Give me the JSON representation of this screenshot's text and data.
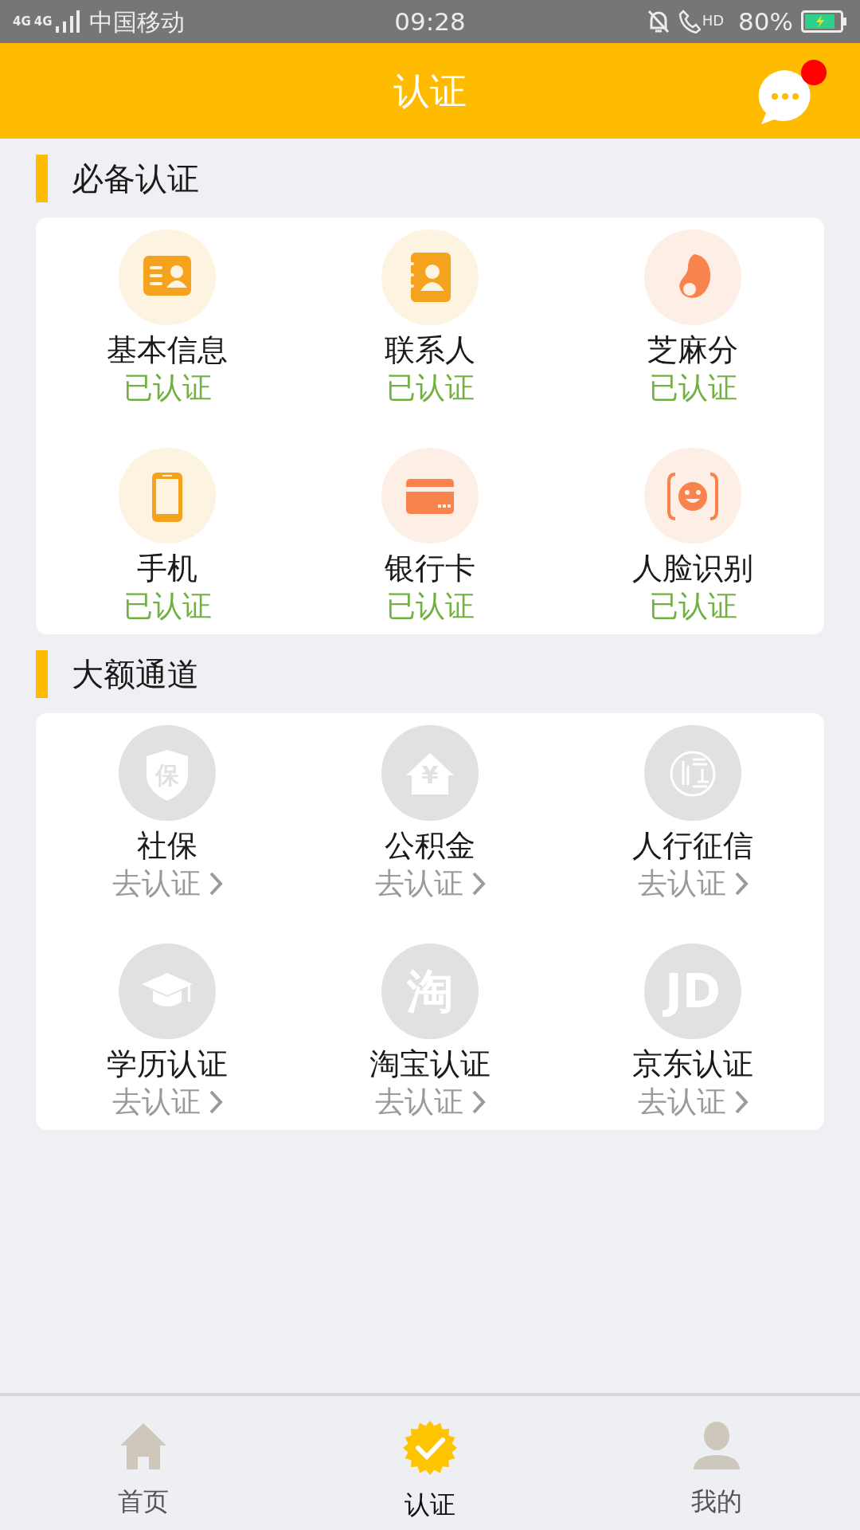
{
  "status_bar": {
    "network": "4G",
    "network2": "4G",
    "carrier": "中国移动",
    "time": "09:28",
    "hd": "HD",
    "battery": "80%"
  },
  "header": {
    "title": "认证",
    "has_unread": true
  },
  "sections": [
    {
      "title": "必备认证",
      "items": [
        {
          "kind": "id-card",
          "name": "基本信息",
          "status": "已认证",
          "verified": true
        },
        {
          "kind": "contacts",
          "name": "联系人",
          "status": "已认证",
          "verified": true
        },
        {
          "kind": "drop",
          "name": "芝麻分",
          "status": "已认证",
          "verified": true
        },
        {
          "kind": "phone",
          "name": "手机",
          "status": "已认证",
          "verified": true
        },
        {
          "kind": "card",
          "name": "银行卡",
          "status": "已认证",
          "verified": true
        },
        {
          "kind": "face",
          "name": "人脸识别",
          "status": "已认证",
          "verified": true
        }
      ]
    },
    {
      "title": "大额通道",
      "items": [
        {
          "kind": "shield",
          "icon_text": "保",
          "name": "社保",
          "status": "去认证",
          "verified": false
        },
        {
          "kind": "house",
          "icon_text": "¥",
          "name": "公积金",
          "status": "去认证",
          "verified": false
        },
        {
          "kind": "seal",
          "name": "人行征信",
          "status": "去认证",
          "verified": false
        },
        {
          "kind": "cap",
          "name": "学历认证",
          "status": "去认证",
          "verified": false
        },
        {
          "kind": "letter",
          "icon_text": "淘",
          "name": "淘宝认证",
          "status": "去认证",
          "verified": false
        },
        {
          "kind": "letter",
          "icon_text": "JD",
          "name": "京东认证",
          "status": "去认证",
          "verified": false
        }
      ]
    }
  ],
  "tabs": [
    {
      "kind": "home",
      "label": "首页",
      "selected": false
    },
    {
      "kind": "badge",
      "label": "认证",
      "selected": true
    },
    {
      "kind": "person",
      "label": "我的",
      "selected": false
    }
  ]
}
